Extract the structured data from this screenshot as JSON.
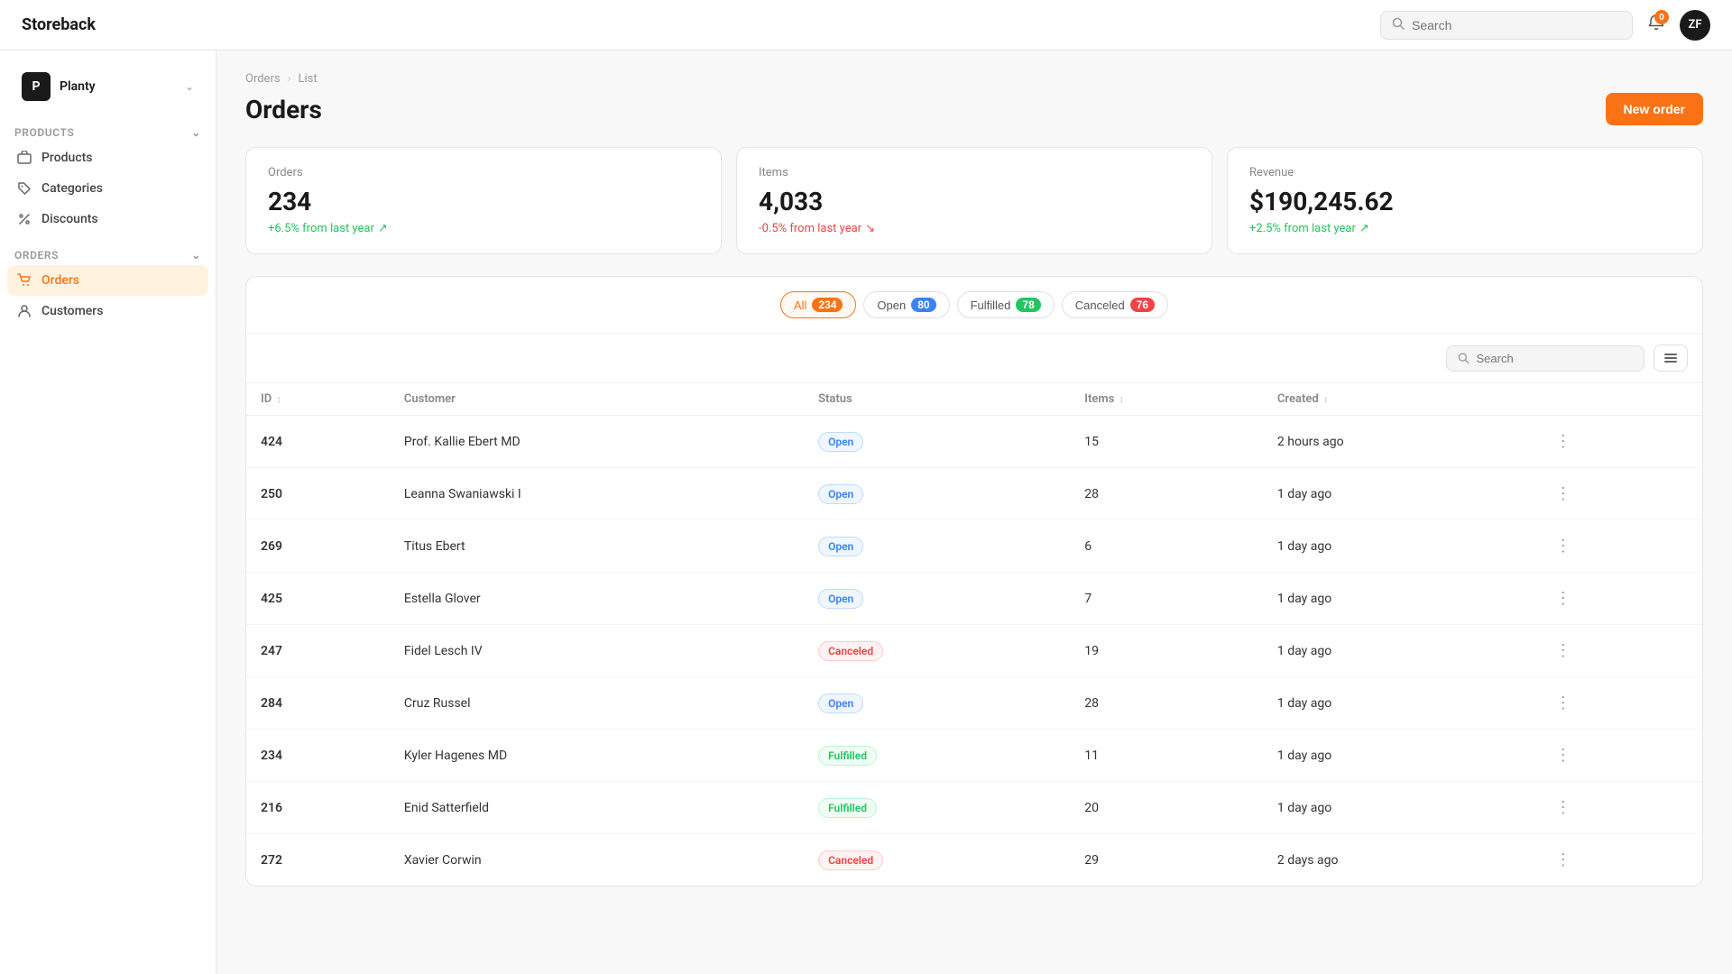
{
  "app": {
    "name": "Storeback"
  },
  "topbar": {
    "search_placeholder": "Search",
    "avatar_initials": "ZF",
    "bell_badge": "0"
  },
  "sidebar": {
    "org": {
      "icon": "P",
      "name": "Planty"
    },
    "sections": [
      {
        "id": "products",
        "title": "Products",
        "items": [
          {
            "id": "products",
            "label": "Products",
            "icon": "box"
          },
          {
            "id": "categories",
            "label": "Categories",
            "icon": "tag"
          },
          {
            "id": "discounts",
            "label": "Discounts",
            "icon": "percent"
          }
        ]
      },
      {
        "id": "orders",
        "title": "Orders",
        "items": [
          {
            "id": "orders",
            "label": "Orders",
            "icon": "cart",
            "active": true
          },
          {
            "id": "customers",
            "label": "Customers",
            "icon": "person"
          }
        ]
      }
    ]
  },
  "breadcrumb": {
    "items": [
      "Orders",
      "List"
    ]
  },
  "page": {
    "title": "Orders",
    "new_order_label": "New order"
  },
  "stats": [
    {
      "label": "Orders",
      "value": "234",
      "change": "+6.5% from last year",
      "change_type": "positive"
    },
    {
      "label": "Items",
      "value": "4,033",
      "change": "-0.5% from last year",
      "change_type": "negative"
    },
    {
      "label": "Revenue",
      "value": "$190,245.62",
      "change": "+2.5% from last year",
      "change_type": "positive"
    }
  ],
  "filters": [
    {
      "id": "all",
      "label": "All",
      "count": "234",
      "badge_class": "badge-all",
      "active": true
    },
    {
      "id": "open",
      "label": "Open",
      "count": "80",
      "badge_class": "badge-open",
      "active": false
    },
    {
      "id": "fulfilled",
      "label": "Fulfilled",
      "count": "78",
      "badge_class": "badge-fulfilled",
      "active": false
    },
    {
      "id": "canceled",
      "label": "Canceled",
      "count": "76",
      "badge_class": "badge-canceled",
      "active": false
    }
  ],
  "table": {
    "search_placeholder": "Search",
    "columns": [
      "ID",
      "Customer",
      "Status",
      "Items",
      "Created"
    ],
    "rows": [
      {
        "id": "424",
        "customer": "Prof. Kallie Ebert MD",
        "status": "Open",
        "status_class": "status-open",
        "items": "15",
        "created": "2 hours ago"
      },
      {
        "id": "250",
        "customer": "Leanna Swaniawski I",
        "status": "Open",
        "status_class": "status-open",
        "items": "28",
        "created": "1 day ago"
      },
      {
        "id": "269",
        "customer": "Titus Ebert",
        "status": "Open",
        "status_class": "status-open",
        "items": "6",
        "created": "1 day ago"
      },
      {
        "id": "425",
        "customer": "Estella Glover",
        "status": "Open",
        "status_class": "status-open",
        "items": "7",
        "created": "1 day ago"
      },
      {
        "id": "247",
        "customer": "Fidel Lesch IV",
        "status": "Canceled",
        "status_class": "status-canceled",
        "items": "19",
        "created": "1 day ago"
      },
      {
        "id": "284",
        "customer": "Cruz Russel",
        "status": "Open",
        "status_class": "status-open",
        "items": "28",
        "created": "1 day ago"
      },
      {
        "id": "234",
        "customer": "Kyler Hagenes MD",
        "status": "Fulfilled",
        "status_class": "status-fulfilled",
        "items": "11",
        "created": "1 day ago"
      },
      {
        "id": "216",
        "customer": "Enid Satterfield",
        "status": "Fulfilled",
        "status_class": "status-fulfilled",
        "items": "20",
        "created": "1 day ago"
      },
      {
        "id": "272",
        "customer": "Xavier Corwin",
        "status": "Canceled",
        "status_class": "status-canceled",
        "items": "29",
        "created": "2 days ago"
      }
    ]
  }
}
